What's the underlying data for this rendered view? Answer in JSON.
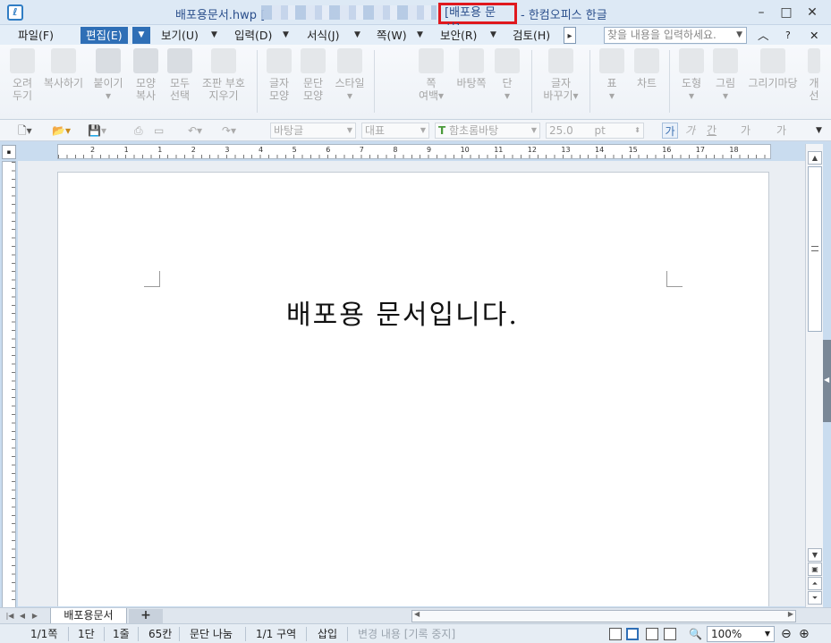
{
  "titlebar": {
    "doc_name": "배포용문서.hwp [",
    "badge": "[배포용 문서]",
    "app_name": "- 한컴오피스 한글",
    "minimize": "–",
    "maximize": "□",
    "close": "✕"
  },
  "menu": {
    "items": [
      "파일(F)",
      "편집(E)",
      "보기(U)",
      "입력(D)",
      "서식(J)",
      "쪽(W)",
      "보안(R)",
      "검토(H)"
    ],
    "active": "편집(E)",
    "more": "▸",
    "search_placeholder": "찾을 내용을 입력하세요.",
    "ribbon_collapse": "︿",
    "help": "?",
    "close": "✕"
  },
  "ribbon": {
    "buttons": [
      {
        "label1": "오려",
        "label2": "두기"
      },
      {
        "label1": "복사하기",
        "label2": ""
      },
      {
        "label1": "붙이기",
        "label2": "▾"
      },
      {
        "label1": "모양",
        "label2": "복사"
      },
      {
        "label1": "모두",
        "label2": "선택"
      },
      {
        "label1": "조판 부호",
        "label2": "지우기"
      },
      {
        "label1": "글자",
        "label2": "모양"
      },
      {
        "label1": "문단",
        "label2": "모양"
      },
      {
        "label1": "스타일",
        "label2": "▾"
      },
      {
        "label1": "쪽",
        "label2": "여백▾"
      },
      {
        "label1": "바탕쪽",
        "label2": ""
      },
      {
        "label1": "단",
        "label2": "▾"
      },
      {
        "label1": "글자",
        "label2": "바꾸기▾"
      },
      {
        "label1": "표",
        "label2": "▾"
      },
      {
        "label1": "차트",
        "label2": ""
      },
      {
        "label1": "도형",
        "label2": "▾"
      },
      {
        "label1": "그림",
        "label2": "▾"
      },
      {
        "label1": "그리기마당",
        "label2": ""
      },
      {
        "label1": "개",
        "label2": "선"
      }
    ]
  },
  "format": {
    "style": "바탕글",
    "lang": "대표",
    "font": "함초롬바탕",
    "size": "25.0",
    "unit": "pt",
    "bold": "가",
    "italic": "가",
    "underline": "간",
    "strike": "가",
    "color": "가"
  },
  "ruler": {
    "h_labels": [
      "2",
      "1",
      "1",
      "2",
      "3",
      "4",
      "5",
      "6",
      "7",
      "8",
      "9",
      "10",
      "11",
      "12",
      "13",
      "14",
      "15",
      "16",
      "17",
      "18"
    ]
  },
  "document": {
    "text": "배포용 문서입니다."
  },
  "tabs": {
    "doc_tab": "배포용문서",
    "add": "+"
  },
  "status": {
    "page": "1/1쪽",
    "column": "1단",
    "line": "1줄",
    "col": "65칸",
    "para": "문단 나눔",
    "section": "1/1 구역",
    "mode": "삽입",
    "track": "변경 내용 [기록 중지]",
    "zoom": "100%"
  },
  "colors": {
    "accent": "#2f6fb6",
    "badge_border": "#e0181e",
    "title_text": "#2b4f8c"
  }
}
